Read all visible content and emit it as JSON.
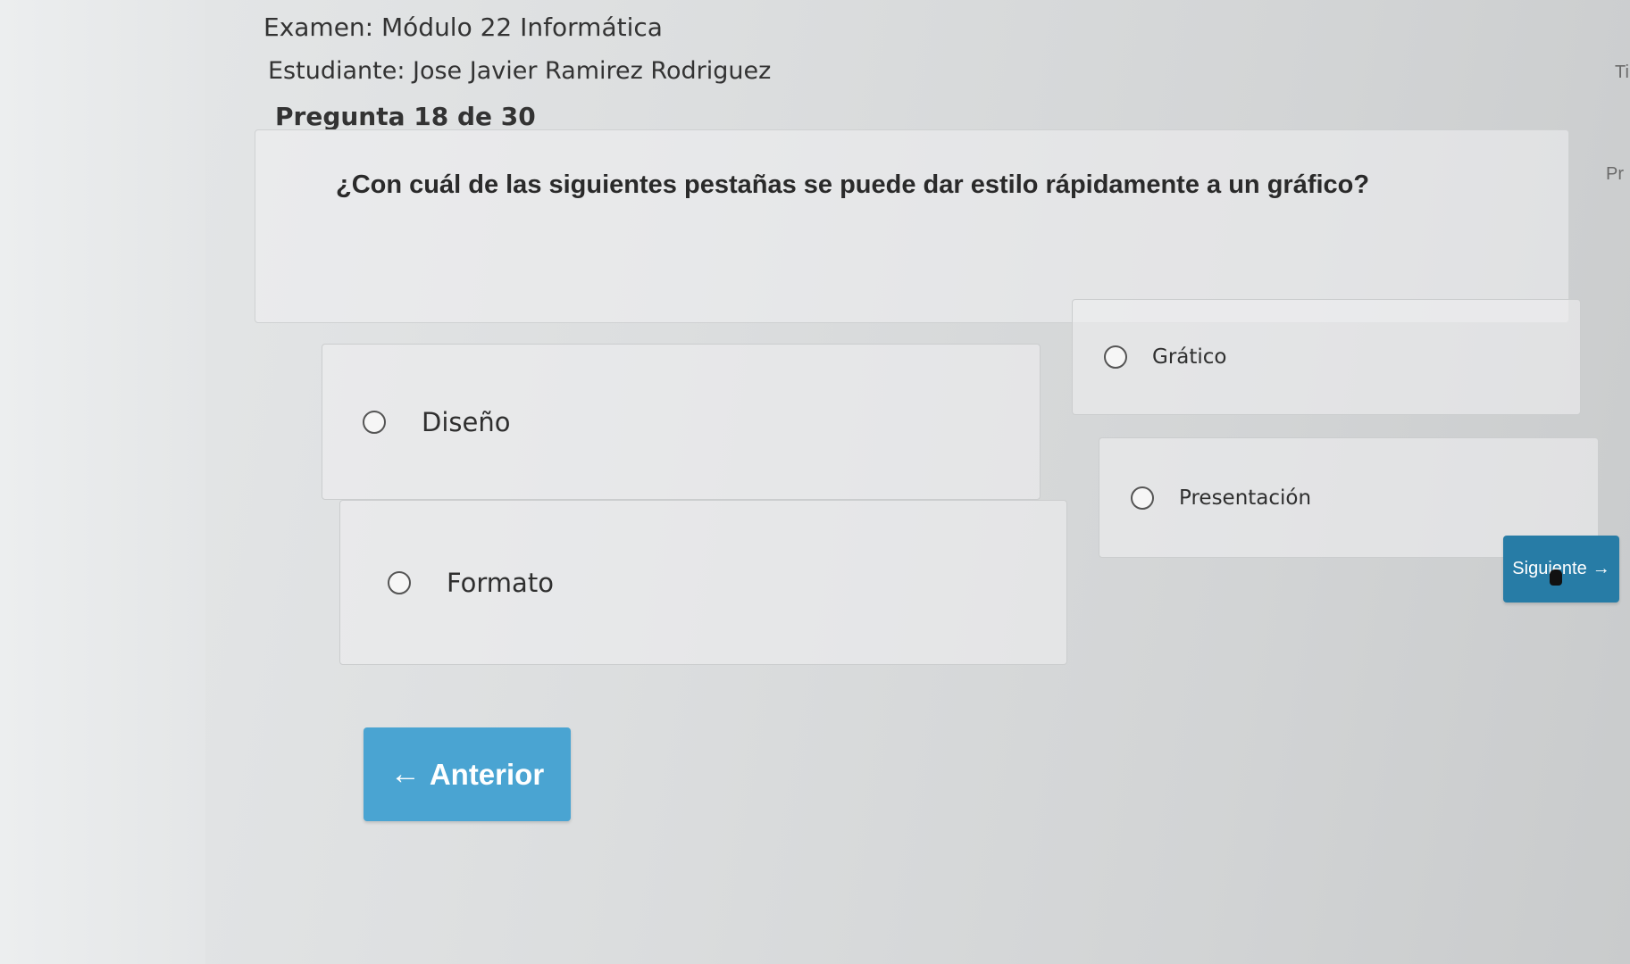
{
  "header": {
    "exam_title": "Examen: Módulo 22 Informática",
    "student": "Estudiante: Jose Javier Ramirez Rodriguez",
    "question_counter": "Pregunta 18 de 30"
  },
  "edge_fragments": {
    "top_right": "Ti",
    "mid_right": "Pr"
  },
  "question": {
    "text": "¿Con cuál de las siguientes pestañas se puede dar estilo rápidamente a un gráfico?"
  },
  "options": [
    {
      "label": "Diseño"
    },
    {
      "label": "Grático"
    },
    {
      "label": "Formato"
    },
    {
      "label": "Presentación"
    }
  ],
  "nav": {
    "prev_label": "Anterior",
    "prev_icon": "arrow-left-icon",
    "next_label": "Siguiente",
    "next_icon": "arrow-right-icon"
  }
}
